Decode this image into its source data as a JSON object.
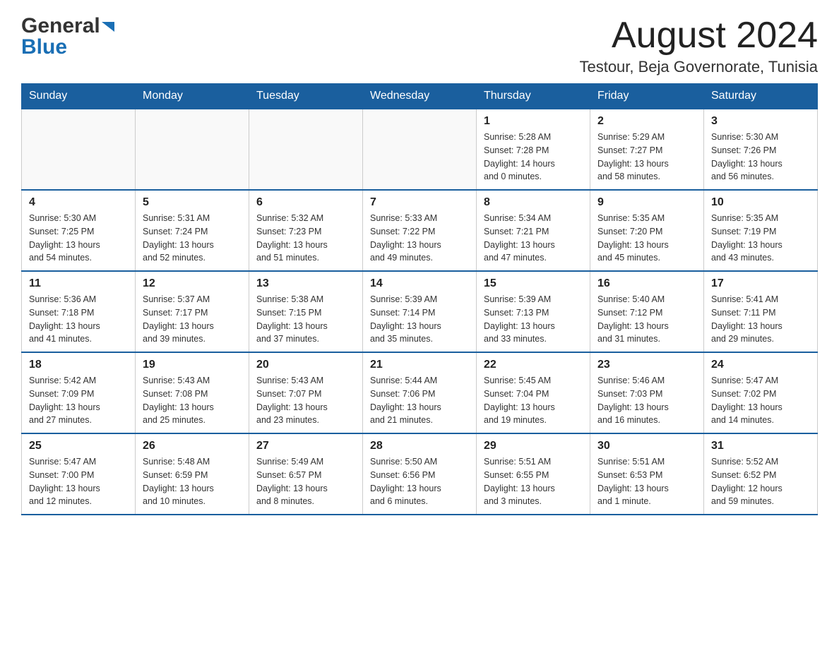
{
  "header": {
    "logo_general": "General",
    "logo_blue": "Blue",
    "month_title": "August 2024",
    "location": "Testour, Beja Governorate, Tunisia"
  },
  "calendar": {
    "days_of_week": [
      "Sunday",
      "Monday",
      "Tuesday",
      "Wednesday",
      "Thursday",
      "Friday",
      "Saturday"
    ],
    "weeks": [
      [
        {
          "day": "",
          "info": ""
        },
        {
          "day": "",
          "info": ""
        },
        {
          "day": "",
          "info": ""
        },
        {
          "day": "",
          "info": ""
        },
        {
          "day": "1",
          "info": "Sunrise: 5:28 AM\nSunset: 7:28 PM\nDaylight: 14 hours\nand 0 minutes."
        },
        {
          "day": "2",
          "info": "Sunrise: 5:29 AM\nSunset: 7:27 PM\nDaylight: 13 hours\nand 58 minutes."
        },
        {
          "day": "3",
          "info": "Sunrise: 5:30 AM\nSunset: 7:26 PM\nDaylight: 13 hours\nand 56 minutes."
        }
      ],
      [
        {
          "day": "4",
          "info": "Sunrise: 5:30 AM\nSunset: 7:25 PM\nDaylight: 13 hours\nand 54 minutes."
        },
        {
          "day": "5",
          "info": "Sunrise: 5:31 AM\nSunset: 7:24 PM\nDaylight: 13 hours\nand 52 minutes."
        },
        {
          "day": "6",
          "info": "Sunrise: 5:32 AM\nSunset: 7:23 PM\nDaylight: 13 hours\nand 51 minutes."
        },
        {
          "day": "7",
          "info": "Sunrise: 5:33 AM\nSunset: 7:22 PM\nDaylight: 13 hours\nand 49 minutes."
        },
        {
          "day": "8",
          "info": "Sunrise: 5:34 AM\nSunset: 7:21 PM\nDaylight: 13 hours\nand 47 minutes."
        },
        {
          "day": "9",
          "info": "Sunrise: 5:35 AM\nSunset: 7:20 PM\nDaylight: 13 hours\nand 45 minutes."
        },
        {
          "day": "10",
          "info": "Sunrise: 5:35 AM\nSunset: 7:19 PM\nDaylight: 13 hours\nand 43 minutes."
        }
      ],
      [
        {
          "day": "11",
          "info": "Sunrise: 5:36 AM\nSunset: 7:18 PM\nDaylight: 13 hours\nand 41 minutes."
        },
        {
          "day": "12",
          "info": "Sunrise: 5:37 AM\nSunset: 7:17 PM\nDaylight: 13 hours\nand 39 minutes."
        },
        {
          "day": "13",
          "info": "Sunrise: 5:38 AM\nSunset: 7:15 PM\nDaylight: 13 hours\nand 37 minutes."
        },
        {
          "day": "14",
          "info": "Sunrise: 5:39 AM\nSunset: 7:14 PM\nDaylight: 13 hours\nand 35 minutes."
        },
        {
          "day": "15",
          "info": "Sunrise: 5:39 AM\nSunset: 7:13 PM\nDaylight: 13 hours\nand 33 minutes."
        },
        {
          "day": "16",
          "info": "Sunrise: 5:40 AM\nSunset: 7:12 PM\nDaylight: 13 hours\nand 31 minutes."
        },
        {
          "day": "17",
          "info": "Sunrise: 5:41 AM\nSunset: 7:11 PM\nDaylight: 13 hours\nand 29 minutes."
        }
      ],
      [
        {
          "day": "18",
          "info": "Sunrise: 5:42 AM\nSunset: 7:09 PM\nDaylight: 13 hours\nand 27 minutes."
        },
        {
          "day": "19",
          "info": "Sunrise: 5:43 AM\nSunset: 7:08 PM\nDaylight: 13 hours\nand 25 minutes."
        },
        {
          "day": "20",
          "info": "Sunrise: 5:43 AM\nSunset: 7:07 PM\nDaylight: 13 hours\nand 23 minutes."
        },
        {
          "day": "21",
          "info": "Sunrise: 5:44 AM\nSunset: 7:06 PM\nDaylight: 13 hours\nand 21 minutes."
        },
        {
          "day": "22",
          "info": "Sunrise: 5:45 AM\nSunset: 7:04 PM\nDaylight: 13 hours\nand 19 minutes."
        },
        {
          "day": "23",
          "info": "Sunrise: 5:46 AM\nSunset: 7:03 PM\nDaylight: 13 hours\nand 16 minutes."
        },
        {
          "day": "24",
          "info": "Sunrise: 5:47 AM\nSunset: 7:02 PM\nDaylight: 13 hours\nand 14 minutes."
        }
      ],
      [
        {
          "day": "25",
          "info": "Sunrise: 5:47 AM\nSunset: 7:00 PM\nDaylight: 13 hours\nand 12 minutes."
        },
        {
          "day": "26",
          "info": "Sunrise: 5:48 AM\nSunset: 6:59 PM\nDaylight: 13 hours\nand 10 minutes."
        },
        {
          "day": "27",
          "info": "Sunrise: 5:49 AM\nSunset: 6:57 PM\nDaylight: 13 hours\nand 8 minutes."
        },
        {
          "day": "28",
          "info": "Sunrise: 5:50 AM\nSunset: 6:56 PM\nDaylight: 13 hours\nand 6 minutes."
        },
        {
          "day": "29",
          "info": "Sunrise: 5:51 AM\nSunset: 6:55 PM\nDaylight: 13 hours\nand 3 minutes."
        },
        {
          "day": "30",
          "info": "Sunrise: 5:51 AM\nSunset: 6:53 PM\nDaylight: 13 hours\nand 1 minute."
        },
        {
          "day": "31",
          "info": "Sunrise: 5:52 AM\nSunset: 6:52 PM\nDaylight: 12 hours\nand 59 minutes."
        }
      ]
    ]
  }
}
